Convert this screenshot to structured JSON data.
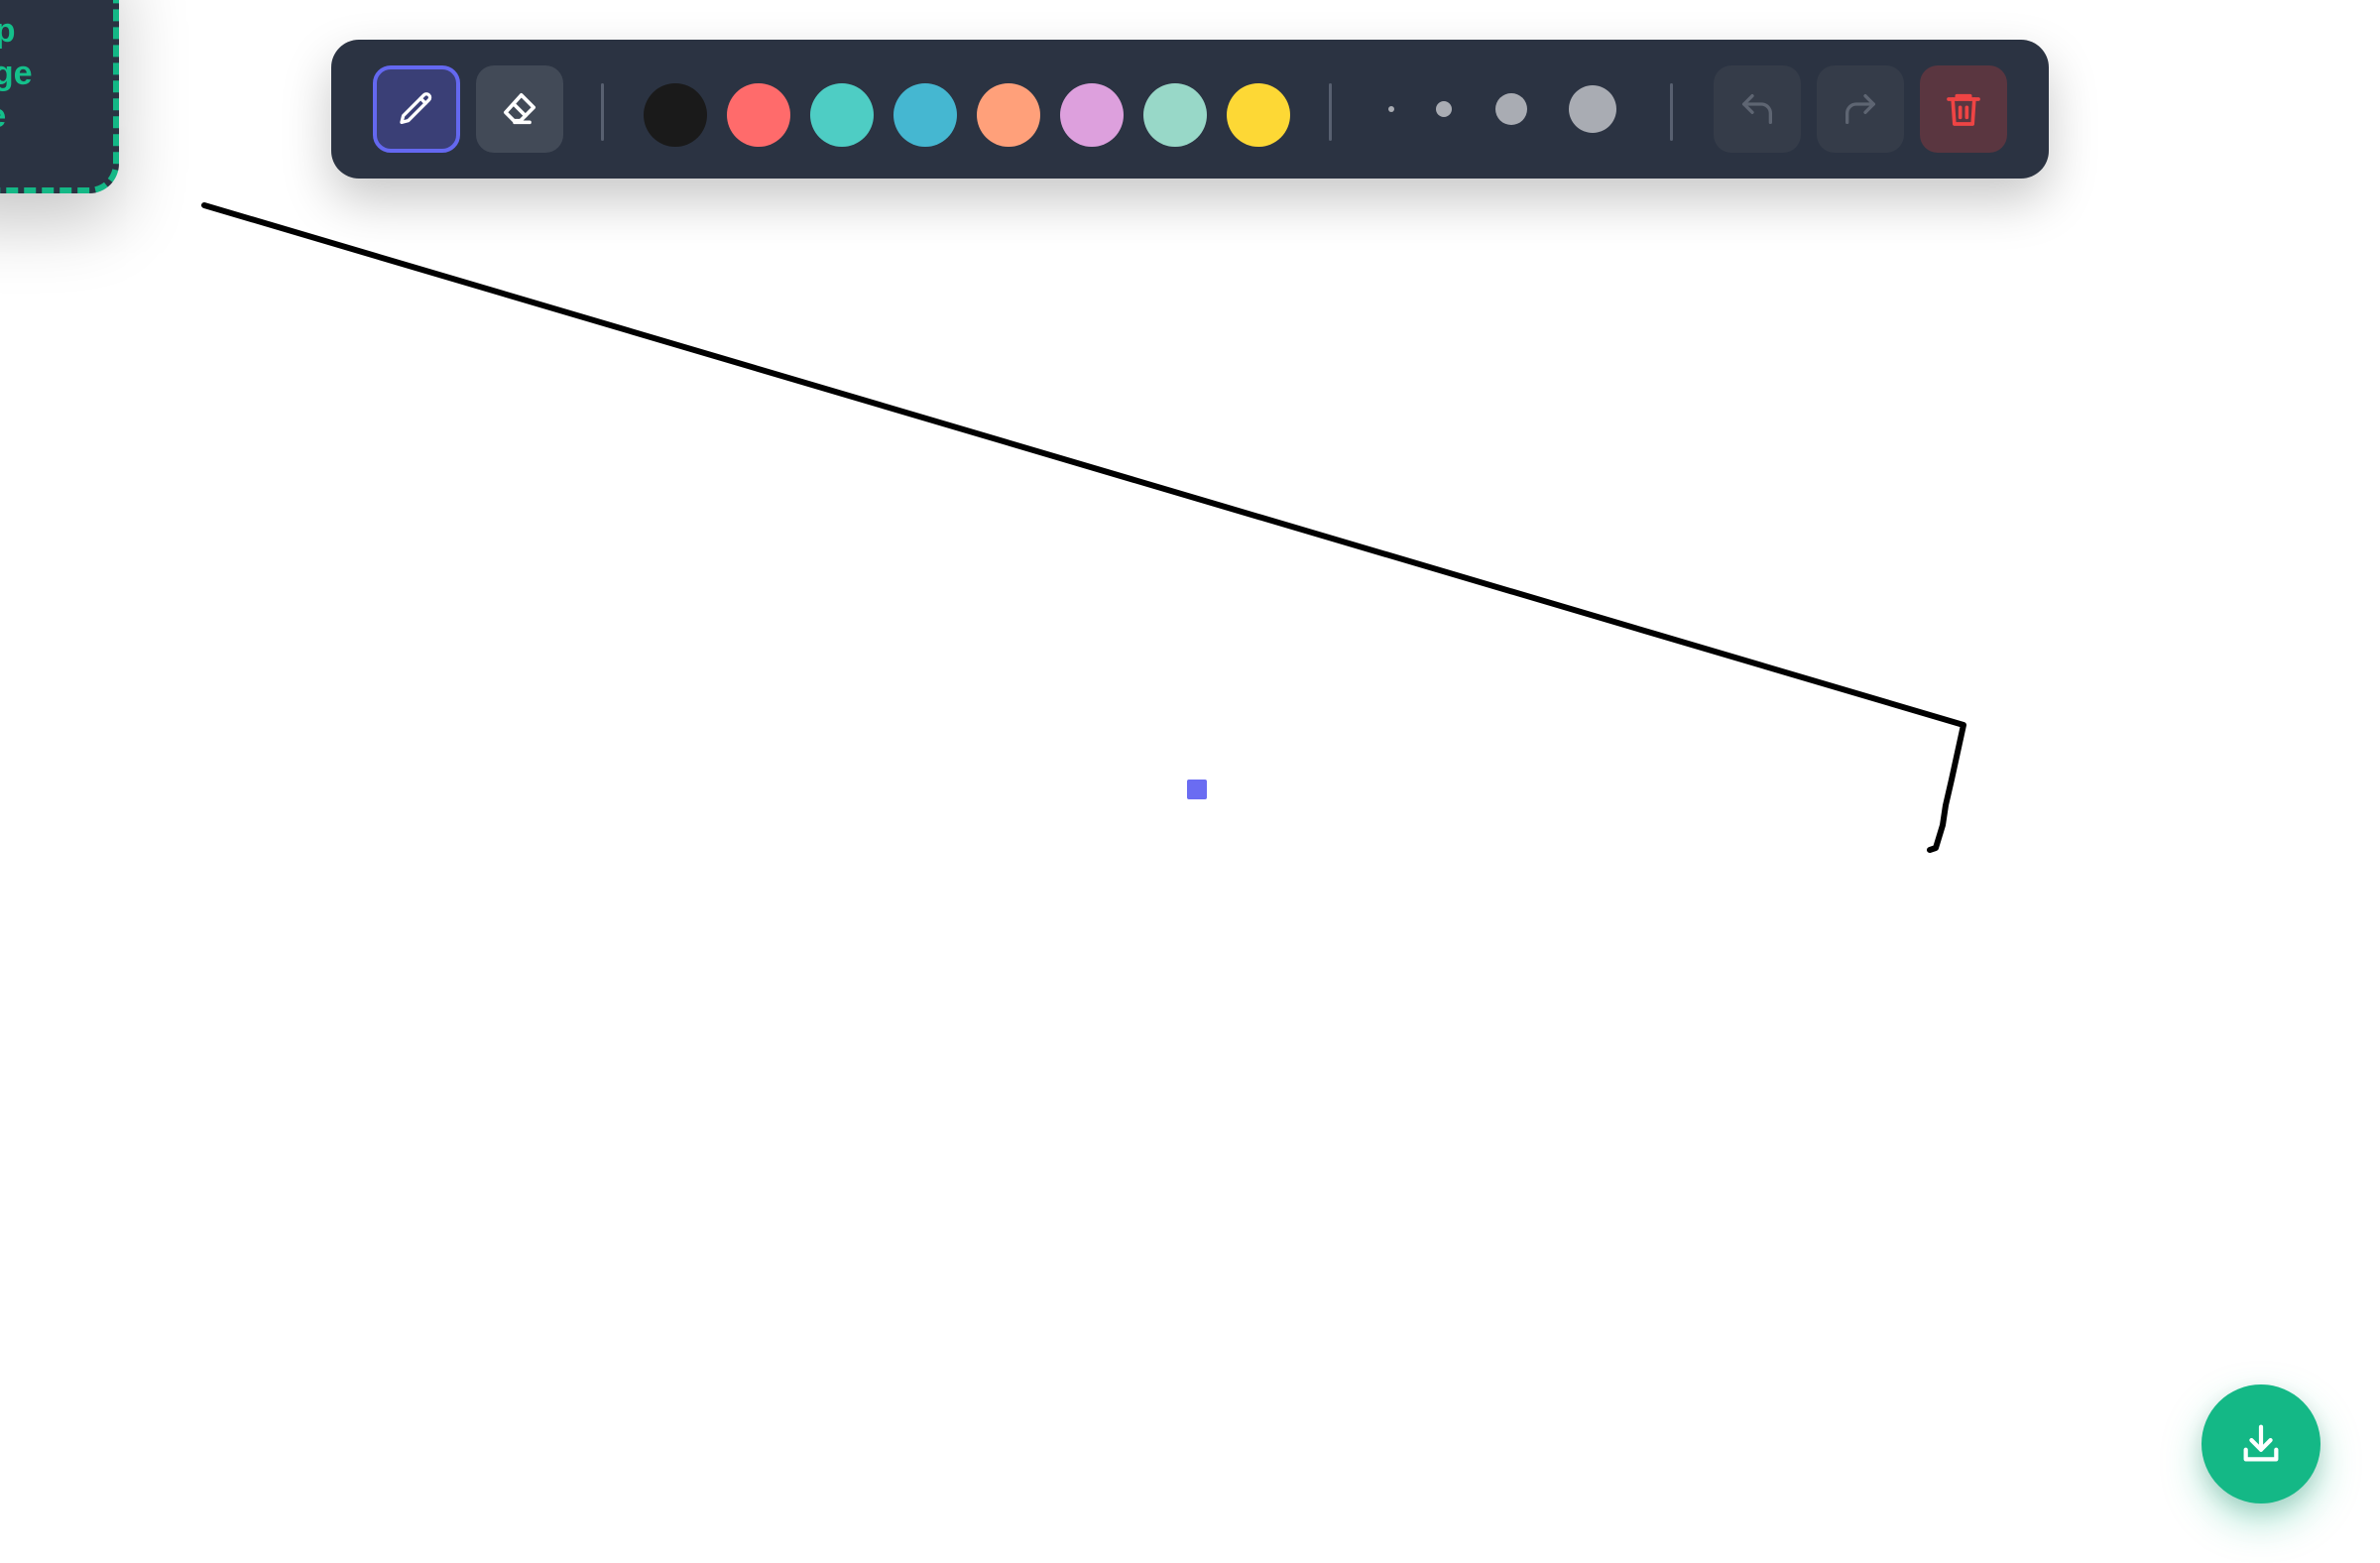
{
  "drop_zone": {
    "lines": [
      "op",
      "age",
      "re"
    ]
  },
  "toolbar": {
    "tools": [
      {
        "name": "pen",
        "icon": "pencil-icon",
        "active": true
      },
      {
        "name": "eraser",
        "icon": "eraser-icon",
        "active": false
      }
    ],
    "colors": [
      "#1a1a1a",
      "#ff6b6b",
      "#4ecdc4",
      "#45b7d1",
      "#ffa07a",
      "#dda0dd",
      "#98d8c8",
      "#fdd835"
    ],
    "brush_sizes": [
      "extra-small",
      "small",
      "medium",
      "large"
    ],
    "actions": [
      {
        "name": "undo",
        "icon": "undo-icon",
        "enabled": false
      },
      {
        "name": "redo",
        "icon": "redo-icon",
        "enabled": false
      },
      {
        "name": "clear",
        "icon": "trash-icon",
        "enabled": true
      }
    ],
    "accent_color": "#6468f0",
    "danger_color": "#ef4444"
  },
  "drawing": {
    "stroke_color": "#000000"
  },
  "download_button": {
    "icon": "download-icon",
    "color": "#14b886"
  }
}
